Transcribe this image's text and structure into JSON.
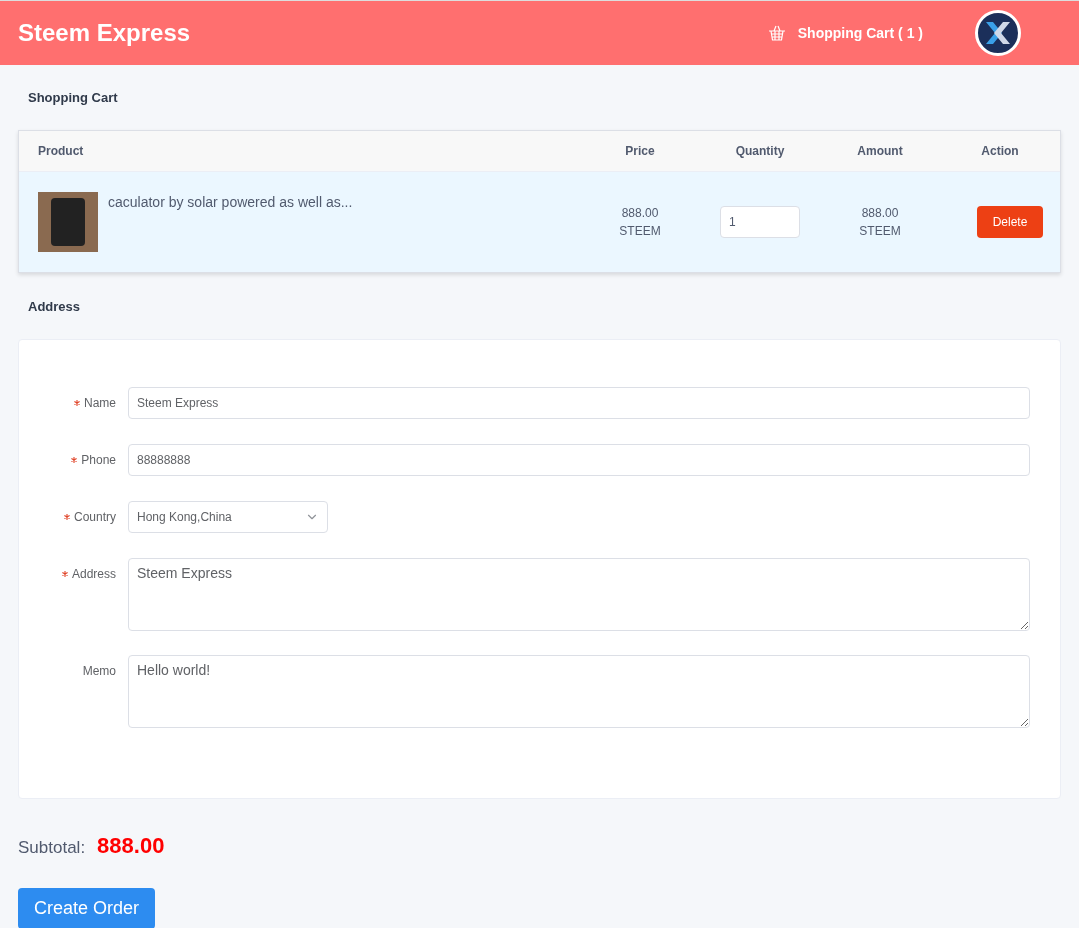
{
  "header": {
    "title": "Steem Express",
    "cart_link": "Shopping Cart ( 1 )"
  },
  "cart": {
    "title": "Shopping Cart",
    "columns": [
      "Product",
      "Price",
      "Quantity",
      "Amount",
      "Action"
    ],
    "rows": [
      {
        "product": "caculator by solar powered as well as...",
        "price": [
          "888.00",
          "STEEM"
        ],
        "quantity": "1",
        "amount": [
          "888.00",
          "STEEM"
        ],
        "action": "Delete",
        "selected": true
      }
    ]
  },
  "address": {
    "title": "Address",
    "fields": [
      {
        "label": "Name",
        "kind": "input",
        "required": true,
        "value": "Steem Express"
      },
      {
        "label": "Phone",
        "kind": "input",
        "required": true,
        "value": "88888888"
      },
      {
        "label": "Country",
        "kind": "select",
        "required": true,
        "value": "Hong Kong,China"
      },
      {
        "label": "Address",
        "kind": "textarea",
        "required": true,
        "value": "Steem Express"
      },
      {
        "label": "Memo",
        "kind": "textarea",
        "required": false,
        "value": "Hello world!"
      }
    ]
  },
  "subtotal": {
    "label": "Subtotal:",
    "value": "888.00"
  },
  "submit": "Create Order"
}
